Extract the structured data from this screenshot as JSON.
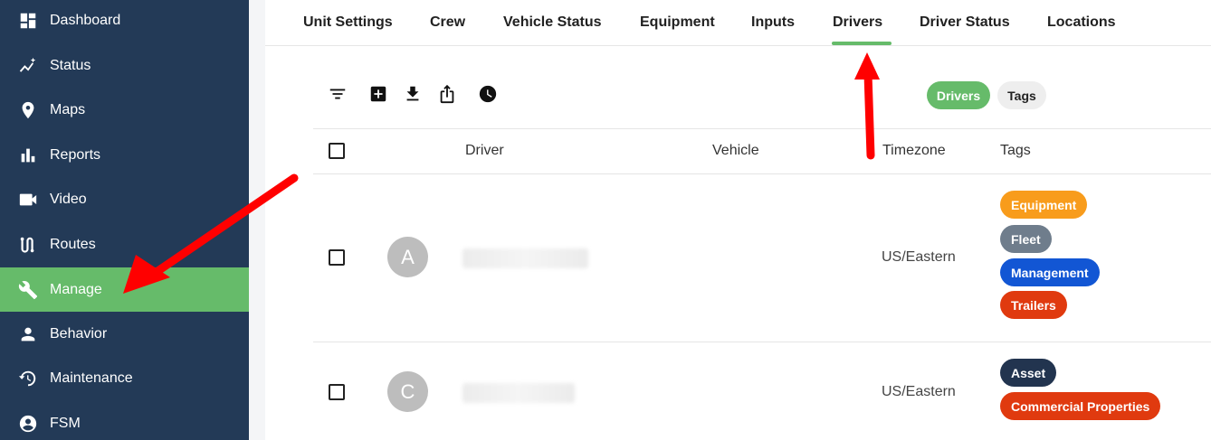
{
  "sidebar": {
    "items": [
      {
        "label": "Dashboard",
        "icon": "dashboard-icon"
      },
      {
        "label": "Status",
        "icon": "status-icon"
      },
      {
        "label": "Maps",
        "icon": "map-pin-icon"
      },
      {
        "label": "Reports",
        "icon": "bar-chart-icon"
      },
      {
        "label": "Video",
        "icon": "video-camera-icon"
      },
      {
        "label": "Routes",
        "icon": "route-icon"
      },
      {
        "label": "Manage",
        "icon": "wrench-icon"
      },
      {
        "label": "Behavior",
        "icon": "person-icon"
      },
      {
        "label": "Maintenance",
        "icon": "maintenance-icon"
      },
      {
        "label": "FSM",
        "icon": "account-circle-icon"
      }
    ],
    "active": "Manage",
    "colors": {
      "background": "#233a57",
      "active": "#66bb6a"
    }
  },
  "tabs": {
    "items": [
      "Unit Settings",
      "Crew",
      "Vehicle Status",
      "Equipment",
      "Inputs",
      "Drivers",
      "Driver Status",
      "Locations"
    ],
    "active": "Drivers"
  },
  "toolbar": {
    "icons": [
      "filter-icon",
      "add-box-icon",
      "download-icon",
      "share-icon",
      "clock-icon"
    ]
  },
  "view_toggle": {
    "drivers_label": "Drivers",
    "tags_label": "Tags"
  },
  "table": {
    "headers": {
      "driver": "Driver",
      "vehicle": "Vehicle",
      "timezone": "Timezone",
      "tags": "Tags"
    },
    "rows": [
      {
        "initial": "A",
        "timezone": "US/Eastern",
        "tags": [
          {
            "label": "Equipment",
            "color": "#f89c1c"
          },
          {
            "label": "Fleet",
            "color": "#6f7d8c"
          },
          {
            "label": "Management",
            "color": "#1256d4"
          },
          {
            "label": "Trailers",
            "color": "#e03a0f"
          }
        ]
      },
      {
        "initial": "C",
        "timezone": "US/Eastern",
        "tags": [
          {
            "label": "Asset",
            "color": "#22344f"
          },
          {
            "label": "Commercial Properties",
            "color": "#e03a0f"
          }
        ]
      }
    ]
  },
  "annotation": {
    "arrow_color": "#ff0000"
  }
}
